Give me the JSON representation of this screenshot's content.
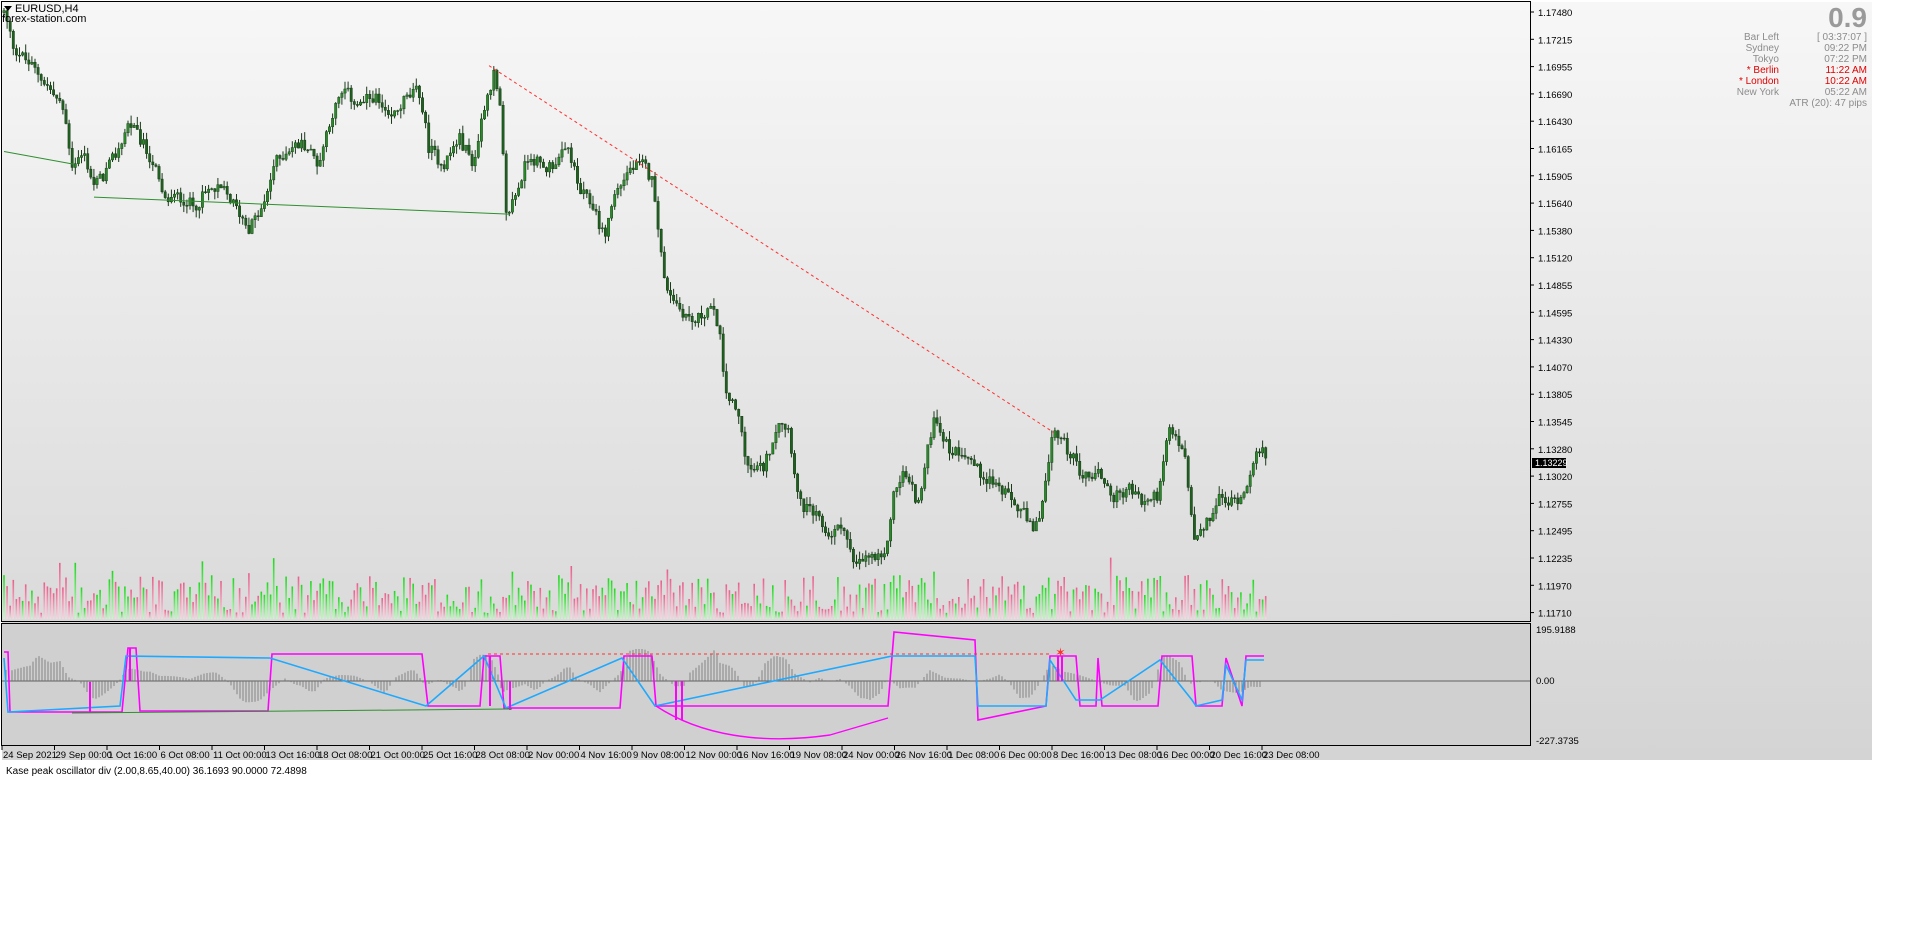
{
  "window": {
    "symbol": "EURUSD,H4",
    "site": "forex-station.com"
  },
  "colors": {
    "bg_top": "#f7f7f7",
    "bg_bottom": "#d4d4d4",
    "candle": "#2a8a2a",
    "candle_wick": "#1a3a1a",
    "trend_green": "#2f8f2f",
    "trend_red": "#ff3030",
    "vol_up": "#40e040",
    "vol_down": "#f08aa8",
    "osc_magenta": "#ff00ff",
    "osc_cyan": "#1ea9ff",
    "osc_hist": "#707070",
    "price_tag_bg": "#000000"
  },
  "info": {
    "value": "0.9",
    "rows": [
      {
        "label": "Bar Left",
        "value": "[ 03:37:07 ]",
        "highlight": false
      },
      {
        "label": "Sydney",
        "value": "09:22 PM",
        "highlight": false
      },
      {
        "label": "Tokyo",
        "value": "07:22 PM",
        "highlight": false
      },
      {
        "label": "* Berlin",
        "value": "11:22 AM",
        "highlight": true
      },
      {
        "label": "* London",
        "value": "10:22 AM",
        "highlight": true
      },
      {
        "label": "New York",
        "value": "05:22 AM",
        "highlight": false
      }
    ],
    "atr": "ATR (20): 47 pips"
  },
  "price_axis": {
    "labels": [
      "1.17480",
      "1.17215",
      "1.16955",
      "1.16690",
      "1.16430",
      "1.16165",
      "1.15905",
      "1.15640",
      "1.15380",
      "1.15120",
      "1.14855",
      "1.14595",
      "1.14330",
      "1.14070",
      "1.13805",
      "1.13545",
      "1.13280",
      "1.13020",
      "1.12755",
      "1.12495",
      "1.12235",
      "1.11970",
      "1.11710"
    ],
    "current": "1.13229"
  },
  "indicator": {
    "title": "Kase peak oscillator div (2.00,8.65,40.00) 36.1693 90.0000 72.4898",
    "axis_top": "195.9188",
    "axis_zero": "0.00",
    "axis_bottom": "-227.3735"
  },
  "time_axis": [
    "24 Sep 2021",
    "29 Sep 00:00",
    "1 Oct 16:00",
    "6 Oct 08:00",
    "11 Oct 00:00",
    "13 Oct 16:00",
    "18 Oct 08:00",
    "21 Oct 00:00",
    "25 Oct 16:00",
    "28 Oct 08:00",
    "2 Nov 00:00",
    "4 Nov 16:00",
    "9 Nov 08:00",
    "12 Nov 00:00",
    "16 Nov 16:00",
    "19 Nov 08:00",
    "24 Nov 00:00",
    "26 Nov 16:00",
    "1 Dec 08:00",
    "6 Dec 00:00",
    "8 Dec 16:00",
    "13 Dec 08:00",
    "16 Dec 00:00",
    "20 Dec 16:00",
    "23 Dec 08:00"
  ],
  "chart_data": {
    "type": "candlestick",
    "price_range": [
      1.1171,
      1.1748
    ],
    "close_path": [
      [
        0,
        1.1738
      ],
      [
        10,
        1.1705
      ],
      [
        20,
        1.1695
      ],
      [
        35,
        1.168
      ],
      [
        50,
        1.166
      ],
      [
        60,
        1.1645
      ],
      [
        68,
        1.1595
      ],
      [
        80,
        1.1605
      ],
      [
        90,
        1.1575
      ],
      [
        100,
        1.1585
      ],
      [
        115,
        1.161
      ],
      [
        125,
        1.1635
      ],
      [
        135,
        1.162
      ],
      [
        150,
        1.1595
      ],
      [
        160,
        1.156
      ],
      [
        175,
        1.1565
      ],
      [
        190,
        1.1555
      ],
      [
        205,
        1.157
      ],
      [
        220,
        1.157
      ],
      [
        235,
        1.155
      ],
      [
        245,
        1.1535
      ],
      [
        260,
        1.1555
      ],
      [
        270,
        1.1595
      ],
      [
        285,
        1.161
      ],
      [
        300,
        1.1615
      ],
      [
        315,
        1.1595
      ],
      [
        325,
        1.1635
      ],
      [
        340,
        1.1665
      ],
      [
        355,
        1.165
      ],
      [
        370,
        1.166
      ],
      [
        385,
        1.1635
      ],
      [
        400,
        1.1655
      ],
      [
        415,
        1.1665
      ],
      [
        425,
        1.161
      ],
      [
        440,
        1.1595
      ],
      [
        455,
        1.162
      ],
      [
        470,
        1.1595
      ],
      [
        480,
        1.165
      ],
      [
        490,
        1.168
      ],
      [
        497,
        1.164
      ],
      [
        502,
        1.1545
      ],
      [
        515,
        1.1575
      ],
      [
        525,
        1.1605
      ],
      [
        540,
        1.159
      ],
      [
        555,
        1.16
      ],
      [
        565,
        1.161
      ],
      [
        575,
        1.157
      ],
      [
        590,
        1.1555
      ],
      [
        600,
        1.1525
      ],
      [
        610,
        1.1565
      ],
      [
        625,
        1.159
      ],
      [
        640,
        1.1595
      ],
      [
        650,
        1.1575
      ],
      [
        660,
        1.1485
      ],
      [
        675,
        1.146
      ],
      [
        690,
        1.1445
      ],
      [
        705,
        1.146
      ],
      [
        715,
        1.1445
      ],
      [
        720,
        1.1385
      ],
      [
        735,
        1.1355
      ],
      [
        745,
        1.1305
      ],
      [
        760,
        1.131
      ],
      [
        775,
        1.1355
      ],
      [
        785,
        1.1345
      ],
      [
        795,
        1.1275
      ],
      [
        810,
        1.1265
      ],
      [
        825,
        1.1245
      ],
      [
        840,
        1.1255
      ],
      [
        850,
        1.1215
      ],
      [
        865,
        1.1225
      ],
      [
        880,
        1.122
      ],
      [
        890,
        1.1285
      ],
      [
        900,
        1.1305
      ],
      [
        915,
        1.1275
      ],
      [
        930,
        1.136
      ],
      [
        945,
        1.1325
      ],
      [
        960,
        1.1325
      ],
      [
        975,
        1.1305
      ],
      [
        990,
        1.1295
      ],
      [
        1005,
        1.128
      ],
      [
        1020,
        1.1265
      ],
      [
        1030,
        1.1245
      ],
      [
        1040,
        1.1285
      ],
      [
        1050,
        1.1345
      ],
      [
        1065,
        1.1325
      ],
      [
        1080,
        1.13
      ],
      [
        1095,
        1.1305
      ],
      [
        1110,
        1.128
      ],
      [
        1125,
        1.129
      ],
      [
        1140,
        1.1275
      ],
      [
        1155,
        1.1285
      ],
      [
        1165,
        1.1345
      ],
      [
        1180,
        1.1325
      ],
      [
        1190,
        1.124
      ],
      [
        1200,
        1.125
      ],
      [
        1215,
        1.128
      ],
      [
        1225,
        1.1275
      ],
      [
        1240,
        1.1285
      ],
      [
        1250,
        1.132
      ],
      [
        1262,
        1.1323
      ]
    ],
    "trendlines": [
      {
        "color": "green",
        "from": [
          0,
          1.1607
        ],
        "to": [
          70,
          1.1595
        ]
      },
      {
        "color": "green",
        "from": [
          90,
          1.1564
        ],
        "to": [
          505,
          1.1548
        ]
      },
      {
        "color": "red",
        "dashed": true,
        "from": [
          485,
          1.1688
        ],
        "to": [
          1050,
          1.1342
        ]
      }
    ]
  }
}
